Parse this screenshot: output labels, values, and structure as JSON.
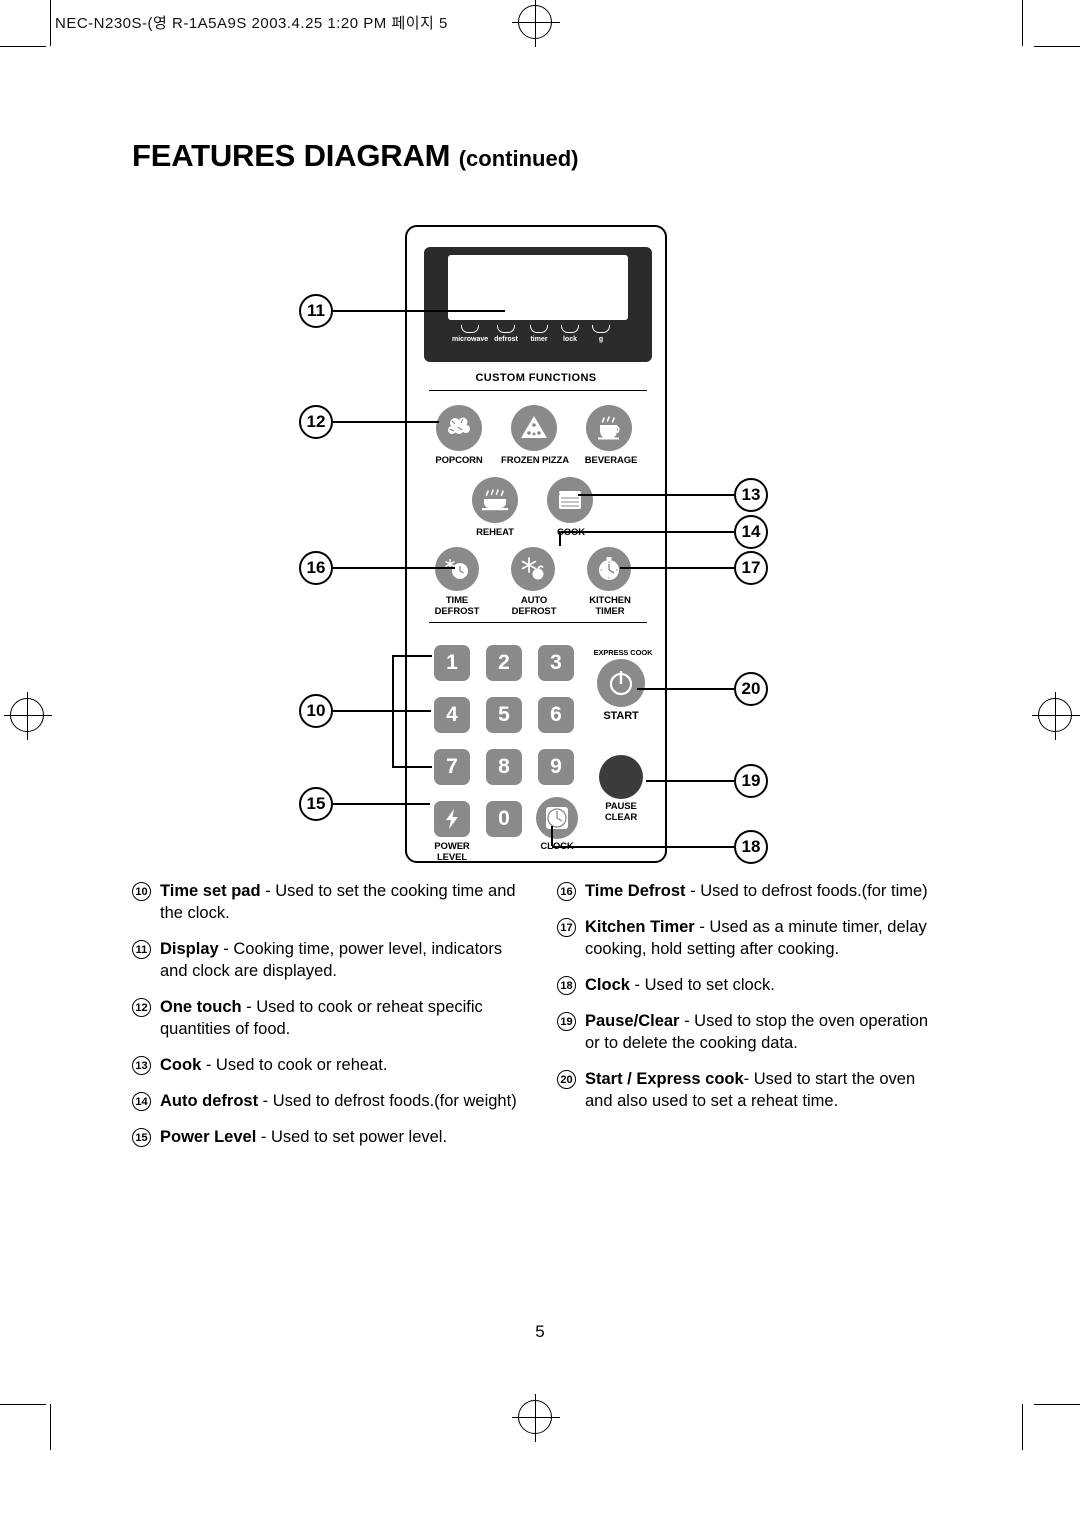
{
  "slug": "NEC-N230S-(영 R-1A5A9S  2003.4.25 1:20 PM  페이지 5",
  "title": "FEATURES DIAGRAM",
  "title_suffix": "(continued)",
  "page_number": "5",
  "panel": {
    "custom_functions_label": "CUSTOM FUNCTIONS",
    "display_indicators": [
      {
        "label": "microwave"
      },
      {
        "label": "defrost"
      },
      {
        "label": "timer"
      },
      {
        "label": "lock"
      },
      {
        "label": "g"
      }
    ],
    "one_touch_buttons": [
      {
        "label": "POPCORN",
        "icon": "popcorn-icon"
      },
      {
        "label": "FROZEN PIZZA",
        "icon": "pizza-icon"
      },
      {
        "label": "BEVERAGE",
        "icon": "cup-icon"
      }
    ],
    "cook_buttons": [
      {
        "label": "REHEAT",
        "icon": "reheat-icon"
      },
      {
        "label": "COOK",
        "icon": "cook-icon"
      }
    ],
    "defrost_buttons": [
      {
        "label": "TIME\nDEFROST",
        "line1": "TIME",
        "line2": "DEFROST",
        "icon": "time-defrost-icon"
      },
      {
        "label": "AUTO\nDEFROST",
        "line1": "AUTO",
        "line2": "DEFROST",
        "icon": "auto-defrost-icon"
      },
      {
        "label": "KITCHEN\nTIMER",
        "line1": "KITCHEN",
        "line2": "TIMER",
        "icon": "kitchen-timer-icon"
      }
    ],
    "keypad": [
      "1",
      "2",
      "3",
      "4",
      "5",
      "6",
      "7",
      "8",
      "9",
      "0"
    ],
    "express_cook_label": "EXPRESS COOK",
    "start_label": "START",
    "pause_label_1": "PAUSE",
    "pause_label_2": "CLEAR",
    "power_level_line1": "POWER",
    "power_level_line2": "LEVEL",
    "clock_label": "CLOCK"
  },
  "callouts": [
    {
      "id": "c11",
      "num": "11"
    },
    {
      "id": "c12",
      "num": "12"
    },
    {
      "id": "c13",
      "num": "13"
    },
    {
      "id": "c14",
      "num": "14"
    },
    {
      "id": "c15",
      "num": "15"
    },
    {
      "id": "c16",
      "num": "16"
    },
    {
      "id": "c17",
      "num": "17"
    },
    {
      "id": "c18",
      "num": "18"
    },
    {
      "id": "c19",
      "num": "19"
    },
    {
      "id": "c20",
      "num": "20"
    },
    {
      "id": "c10",
      "num": "10"
    }
  ],
  "legend": {
    "left": [
      {
        "num": "10",
        "term": "Time set pad",
        "desc": " - Used to set the cooking time and the clock."
      },
      {
        "num": "11",
        "term": "Display",
        "desc": " - Cooking time, power level, indicators and clock are displayed."
      },
      {
        "num": "12",
        "term": "One touch",
        "desc": " - Used to cook or reheat specific quantities of food."
      },
      {
        "num": "13",
        "term": "Cook",
        "desc": " - Used to cook or reheat."
      },
      {
        "num": "14",
        "term": "Auto defrost",
        "desc": " - Used to defrost foods.(for weight)"
      },
      {
        "num": "15",
        "term": "Power Level",
        "desc": " - Used to set power level."
      }
    ],
    "right": [
      {
        "num": "16",
        "term": "Time Defrost",
        "desc": " - Used to defrost foods.(for time)"
      },
      {
        "num": "17",
        "term": "Kitchen Timer",
        "desc": " - Used as a minute timer, delay cooking, hold setting after cooking."
      },
      {
        "num": "18",
        "term": "Clock",
        "desc": " - Used to set clock."
      },
      {
        "num": "19",
        "term": "Pause/Clear",
        "desc": " - Used to stop the oven operation or to delete the cooking data."
      },
      {
        "num": "20",
        "term": "Start / Express cook",
        "desc": "- Used to start the oven and also used to set a reheat time."
      }
    ]
  }
}
